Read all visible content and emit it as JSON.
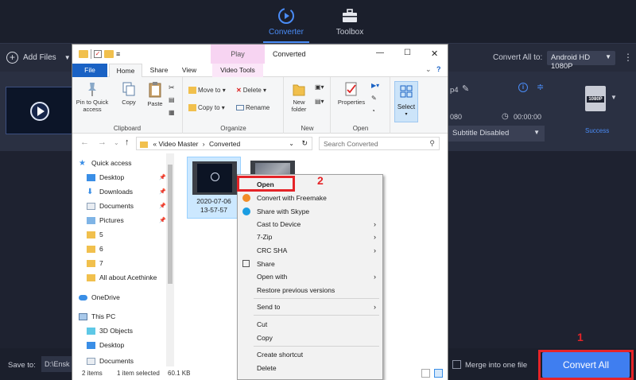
{
  "app": {
    "tabs": [
      {
        "label": "Converter",
        "icon": "converter-icon"
      },
      {
        "label": "Toolbox",
        "icon": "toolbox-icon"
      }
    ],
    "add_files": "Add Files",
    "convert_all_to": "Convert All to:",
    "output_format": "Android HD 1080P",
    "file": {
      "name_suffix": "p4",
      "resolution": "080",
      "duration": "00:00:00",
      "subtitle": "Subtitle Disabled",
      "format_badge": "1080P",
      "status": "Success"
    },
    "save_to_label": "Save to:",
    "save_path": "D:\\Ensk",
    "merge_label": "Merge into one file",
    "convert_all_button": "Convert All",
    "accent_color": "#3f7ef0",
    "annotations": [
      {
        "number": "1",
        "target": "Convert All"
      },
      {
        "number": "2",
        "target": "Open"
      }
    ]
  },
  "explorer": {
    "play_tab": "Play",
    "title": "Converted",
    "ribbon_tabs": [
      "File",
      "Home",
      "Share",
      "View",
      "Video Tools"
    ],
    "ribbon": {
      "clipboard": {
        "label": "Clipboard",
        "pin": "Pin to Quick access",
        "copy": "Copy",
        "paste": "Paste"
      },
      "organize": {
        "label": "Organize",
        "move_to": "Move to",
        "copy_to": "Copy to",
        "delete": "Delete",
        "rename": "Rename"
      },
      "new": {
        "label": "New",
        "new_folder": "New folder"
      },
      "open": {
        "label": "Open",
        "properties": "Properties"
      },
      "select": "Select"
    },
    "address": {
      "prefix": "«",
      "path": [
        "Video Master",
        "Converted"
      ]
    },
    "search_placeholder": "Search Converted",
    "nav_items": [
      {
        "label": "Quick access",
        "icon": "star-icon"
      },
      {
        "label": "Desktop",
        "icon": "desktop-icon",
        "pinned": true
      },
      {
        "label": "Downloads",
        "icon": "download-icon",
        "pinned": true
      },
      {
        "label": "Documents",
        "icon": "documents-icon",
        "pinned": true
      },
      {
        "label": "Pictures",
        "icon": "pictures-icon",
        "pinned": true
      },
      {
        "label": "5",
        "icon": "folder-icon"
      },
      {
        "label": "6",
        "icon": "folder-icon"
      },
      {
        "label": "7",
        "icon": "folder-icon"
      },
      {
        "label": "All about Acethinke",
        "icon": "folder-icon"
      },
      {
        "label": "OneDrive",
        "icon": "cloud-icon"
      },
      {
        "label": "This PC",
        "icon": "computer-icon"
      },
      {
        "label": "3D Objects",
        "icon": "cube-icon"
      },
      {
        "label": "Desktop",
        "icon": "desktop-icon"
      },
      {
        "label": "Documents",
        "icon": "documents-icon"
      }
    ],
    "files": [
      {
        "name_line1": "2020-07-06",
        "name_line2": "13-57-57",
        "selected": true
      }
    ],
    "status": {
      "items": "2 items",
      "selected": "1 item selected",
      "size": "60.1 KB"
    }
  },
  "context_menu": {
    "items": [
      {
        "label": "Open",
        "bold": true
      },
      {
        "label": "Convert with Freemake",
        "icon": "freemake-icon"
      },
      {
        "label": "Share with Skype",
        "icon": "skype-icon"
      },
      {
        "label": "Cast to Device",
        "submenu": true
      },
      {
        "label": "7-Zip",
        "submenu": true
      },
      {
        "label": "CRC SHA",
        "submenu": true
      },
      {
        "label": "Share",
        "icon": "share-icon"
      },
      {
        "label": "Open with",
        "submenu": true
      },
      {
        "label": "Restore previous versions"
      },
      {
        "label": "Send to",
        "submenu": true
      },
      {
        "label": "Cut"
      },
      {
        "label": "Copy"
      },
      {
        "label": "Create shortcut"
      },
      {
        "label": "Delete"
      }
    ]
  }
}
